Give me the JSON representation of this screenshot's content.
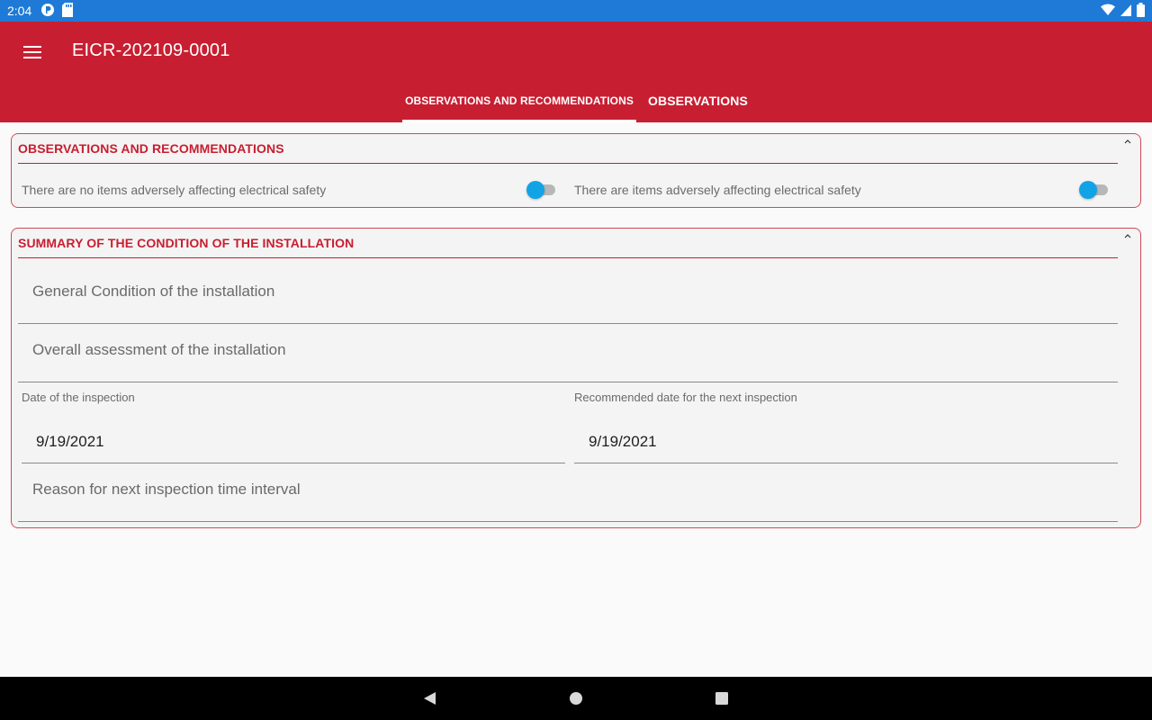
{
  "status_bar": {
    "time": "2:04",
    "icons_left": [
      "podcast-icon",
      "sd-card-icon"
    ],
    "icons_right": [
      "wifi-icon",
      "signal-icon",
      "battery-icon"
    ]
  },
  "app_bar": {
    "title": "EICR-202109-0001",
    "menu_icon": "hamburger-menu-icon",
    "background": "#c81e31",
    "tabs": [
      {
        "label": "OBSERVATIONS AND RECOMMENDATIONS",
        "active": true
      },
      {
        "label": "OBSERVATIONS",
        "active": false
      }
    ]
  },
  "observations_card": {
    "title": "OBSERVATIONS AND RECOMMENDATIONS",
    "toggle_no_items": {
      "label": "There are no items adversely affecting electrical safety",
      "state": "off"
    },
    "toggle_items": {
      "label": "There are items adversely affecting electrical safety",
      "state": "off"
    }
  },
  "summary_card": {
    "title": "SUMMARY OF THE CONDITION OF THE INSTALLATION",
    "general_condition_placeholder": "General Condition of the installation",
    "overall_assessment_placeholder": "Overall assessment of the installation",
    "inspection_date_label": "Date of the inspection",
    "inspection_date_value": "9/19/2021",
    "next_inspection_label": "Recommended date for the next inspection",
    "next_inspection_value": "9/19/2021",
    "reason_placeholder": "Reason for next inspection time interval"
  },
  "colors": {
    "accent": "#c81e31",
    "status_bar": "#1e7ad6",
    "switch_thumb": "#12a3e6"
  },
  "nav_bar": {
    "buttons": [
      "back-icon",
      "home-icon",
      "recents-icon"
    ]
  }
}
